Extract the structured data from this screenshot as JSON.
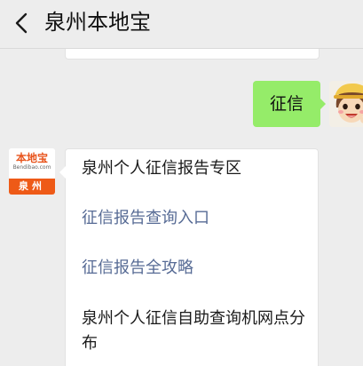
{
  "header": {
    "title": "泉州本地宝"
  },
  "chat": {
    "sent_message": "征信",
    "brand_avatar": {
      "name": "本地宝",
      "url": "Bendibao.com",
      "city": "泉州"
    },
    "reply_items": [
      {
        "text": "泉州个人征信报告专区",
        "is_link": false
      },
      {
        "text": "征信报告查询入口",
        "is_link": true
      },
      {
        "text": "征信报告全攻略",
        "is_link": true
      },
      {
        "text": "泉州个人征信自助查询机网点分布",
        "is_link": false
      }
    ]
  },
  "colors": {
    "background": "#ededed",
    "sent_bubble": "#95ec69",
    "link": "#576b95",
    "brand_orange": "#ee5a17"
  },
  "icons": {
    "back": "chevron-left-icon"
  }
}
